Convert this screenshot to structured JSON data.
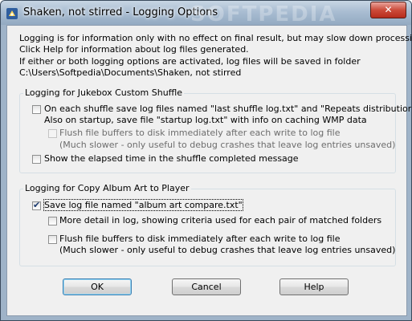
{
  "window": {
    "title": "Shaken, not stirred  -  Logging Options",
    "watermark": "SOFTPEDIA",
    "close_glyph": "✕"
  },
  "intro": {
    "line1": "Logging is for information only with no effect on final result, but may slow down processing.",
    "line2": "Click Help for information about log files generated.",
    "line3": "If either or both logging options are activated, log files will be saved in folder",
    "line4": "C:\\Users\\Softpedia\\Documents\\Shaken, not stirred"
  },
  "jukebox": {
    "title": "Logging for Jukebox Custom Shuffle",
    "opt1_line1": "On each shuffle save log files named \"last shuffle log.txt\" and \"Repeats distribution.csv\"",
    "opt1_line2": "Also on startup, save file \"startup log.txt\" with info on caching WMP data",
    "opt1_checked": false,
    "flush_line1": "Flush file buffers to disk immediately after each write to log file",
    "flush_line2": "(Much slower - only useful to debug crashes that leave log entries unsaved)",
    "flush_checked": false,
    "flush_enabled": false,
    "elapsed_label": "Show the elapsed time in the shuffle completed message",
    "elapsed_checked": false
  },
  "album": {
    "title": "Logging for Copy Album Art to Player",
    "save_label": "Save log file named  \"album art compare.txt\"",
    "save_checked": true,
    "detail_label": "More detail in log, showing criteria used for each pair of matched folders",
    "detail_checked": false,
    "flush_line1": "Flush file buffers to disk immediately after each write to log file",
    "flush_line2": "(Much slower - only useful to debug crashes that leave log entries unsaved)",
    "flush_checked": false
  },
  "buttons": {
    "ok": "OK",
    "cancel": "Cancel",
    "help": "Help"
  },
  "colors": {
    "titlebar": "#a9bdd2",
    "dialog_bg": "#f0f0f0",
    "close_button": "#cc4b3a",
    "default_button_border": "#3c7fb1"
  }
}
